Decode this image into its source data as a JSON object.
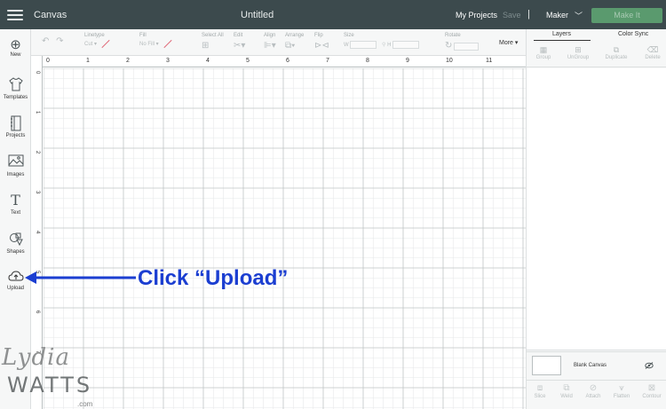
{
  "topbar": {
    "app_title": "Canvas",
    "document_title": "Untitled",
    "my_projects": "My Projects",
    "save": "Save",
    "separator": "|",
    "machine": "Maker",
    "make_it": "Make It"
  },
  "toolbar": {
    "linetype_label": "Linetype",
    "linetype_value": "Cut",
    "fill_label": "Fill",
    "fill_value": "No Fill",
    "select_all_label": "Select All",
    "edit_label": "Edit",
    "align_label": "Align",
    "arrange_label": "Arrange",
    "flip_label": "Flip",
    "size_label": "Size",
    "size_w": "W",
    "size_h": "H",
    "rotate_label": "Rotate",
    "more_label": "More ▾"
  },
  "sidebar": {
    "items": [
      {
        "label": "New",
        "icon": "plus-circle-icon"
      },
      {
        "label": "Templates",
        "icon": "shirt-icon"
      },
      {
        "label": "Projects",
        "icon": "notebook-icon"
      },
      {
        "label": "Images",
        "icon": "image-icon"
      },
      {
        "label": "Text",
        "icon": "text-icon"
      },
      {
        "label": "Shapes",
        "icon": "shapes-icon"
      },
      {
        "label": "Upload",
        "icon": "cloud-upload-icon"
      }
    ]
  },
  "ruler": {
    "top": [
      "0",
      "1",
      "2",
      "3",
      "4",
      "5",
      "6",
      "7",
      "8",
      "9",
      "10",
      "11"
    ],
    "left": [
      "0",
      "1",
      "2",
      "3",
      "4",
      "5",
      "6",
      "7"
    ]
  },
  "right_panel": {
    "tabs": [
      "Layers",
      "Color Sync"
    ],
    "layer_actions": [
      "Group",
      "UnGroup",
      "Duplicate",
      "Delete"
    ],
    "blank_canvas": "Blank Canvas",
    "bottom_actions": [
      "Slice",
      "Weld",
      "Attach",
      "Flatten",
      "Contour"
    ]
  },
  "annotation": {
    "text": "Click “Upload”",
    "color": "#1b3ed1"
  },
  "watermark": {
    "script": "Lydia",
    "block": "WATTS",
    "suffix": ".com"
  },
  "colors": {
    "topbar": "#3c4a4d",
    "make_it": "#5a9a6e",
    "panel": "#f6f7f7"
  }
}
